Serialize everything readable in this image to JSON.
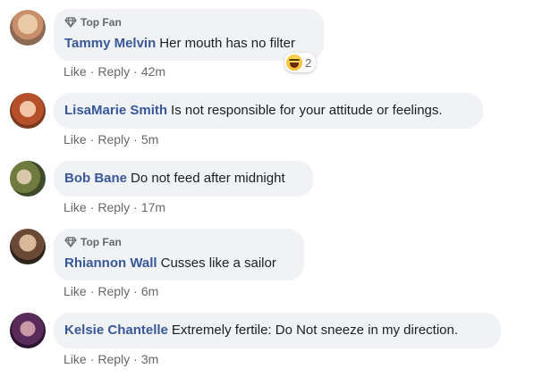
{
  "accent_color": "#385898",
  "comments": [
    {
      "top_fan": true,
      "badge_label": "Top Fan",
      "author": "Tammy Melvin",
      "text": "Her mouth has no filter",
      "like": "Like",
      "reply": "Reply",
      "sep": "·",
      "time": "42m",
      "reaction": {
        "icon": "haha-emoji-icon",
        "count": "2"
      }
    },
    {
      "top_fan": false,
      "author": "LisaMarie Smith",
      "text": "Is not responsible for your attitude or feelings.",
      "like": "Like",
      "reply": "Reply",
      "sep": "·",
      "time": "5m"
    },
    {
      "top_fan": false,
      "author": "Bob Bane",
      "text": "Do not feed after midnight",
      "like": "Like",
      "reply": "Reply",
      "sep": "·",
      "time": "17m"
    },
    {
      "top_fan": true,
      "badge_label": "Top Fan",
      "author": "Rhiannon Wall",
      "text": "Cusses like a sailor",
      "like": "Like",
      "reply": "Reply",
      "sep": "·",
      "time": "6m"
    },
    {
      "top_fan": false,
      "author": "Kelsie Chantelle",
      "text": "Extremely fertile: Do Not sneeze in my direction.",
      "like": "Like",
      "reply": "Reply",
      "sep": "·",
      "time": "3m"
    }
  ]
}
